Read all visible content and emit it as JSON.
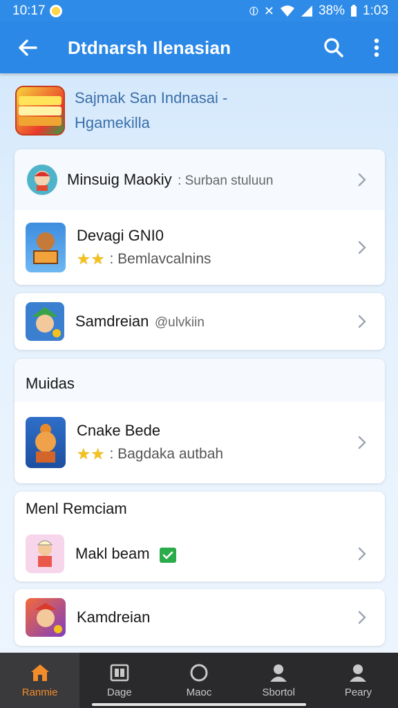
{
  "status_bar": {
    "time": "10:17",
    "battery": "38%",
    "clock_right": "1:03"
  },
  "app_bar": {
    "title": "Dtdnarsh Ilenasian"
  },
  "header": {
    "line1": "Sajmak San Indnasai -",
    "line2": "Hgamekilla"
  },
  "cards": [
    {
      "rows": [
        {
          "title": "Minsuig Maokiy",
          "subtitle_inline": ": Surban stuluun",
          "icon": "game-character-icon"
        },
        {
          "title": "Devagi GNI0",
          "stars": 2,
          "subtitle": ": Bemlavcalnins",
          "icon": "game-tile-icon"
        }
      ]
    },
    {
      "rows": [
        {
          "title": "Samdreian",
          "subtitle_inline": "@ulvkiin",
          "icon": "game-character-icon"
        }
      ]
    },
    {
      "section": "Muidas",
      "rows": [
        {
          "title": "Cnake Bede",
          "stars": 2,
          "subtitle": ": Bagdaka autbah",
          "icon": "game-character-icon"
        }
      ]
    },
    {
      "section": "Menl Remciam",
      "rows": [
        {
          "title": "Makl beam",
          "verified": true,
          "icon": "game-character-icon"
        }
      ]
    },
    {
      "rows": [
        {
          "title": "Kamdreian",
          "icon": "game-character-icon"
        }
      ]
    }
  ],
  "bottom_nav": [
    {
      "label": "Ranmie",
      "icon": "home-icon",
      "active": true
    },
    {
      "label": "Dage",
      "icon": "book-icon",
      "active": false
    },
    {
      "label": "Maoc",
      "icon": "circle-icon",
      "active": false
    },
    {
      "label": "Sbortol",
      "icon": "person-icon",
      "active": false
    },
    {
      "label": "Peary",
      "icon": "person-icon",
      "active": false
    }
  ],
  "colors": {
    "accent": "#2b88e6",
    "nav_active": "#f28b2a",
    "star": "#f3c21c",
    "verified": "#2bab4a"
  }
}
